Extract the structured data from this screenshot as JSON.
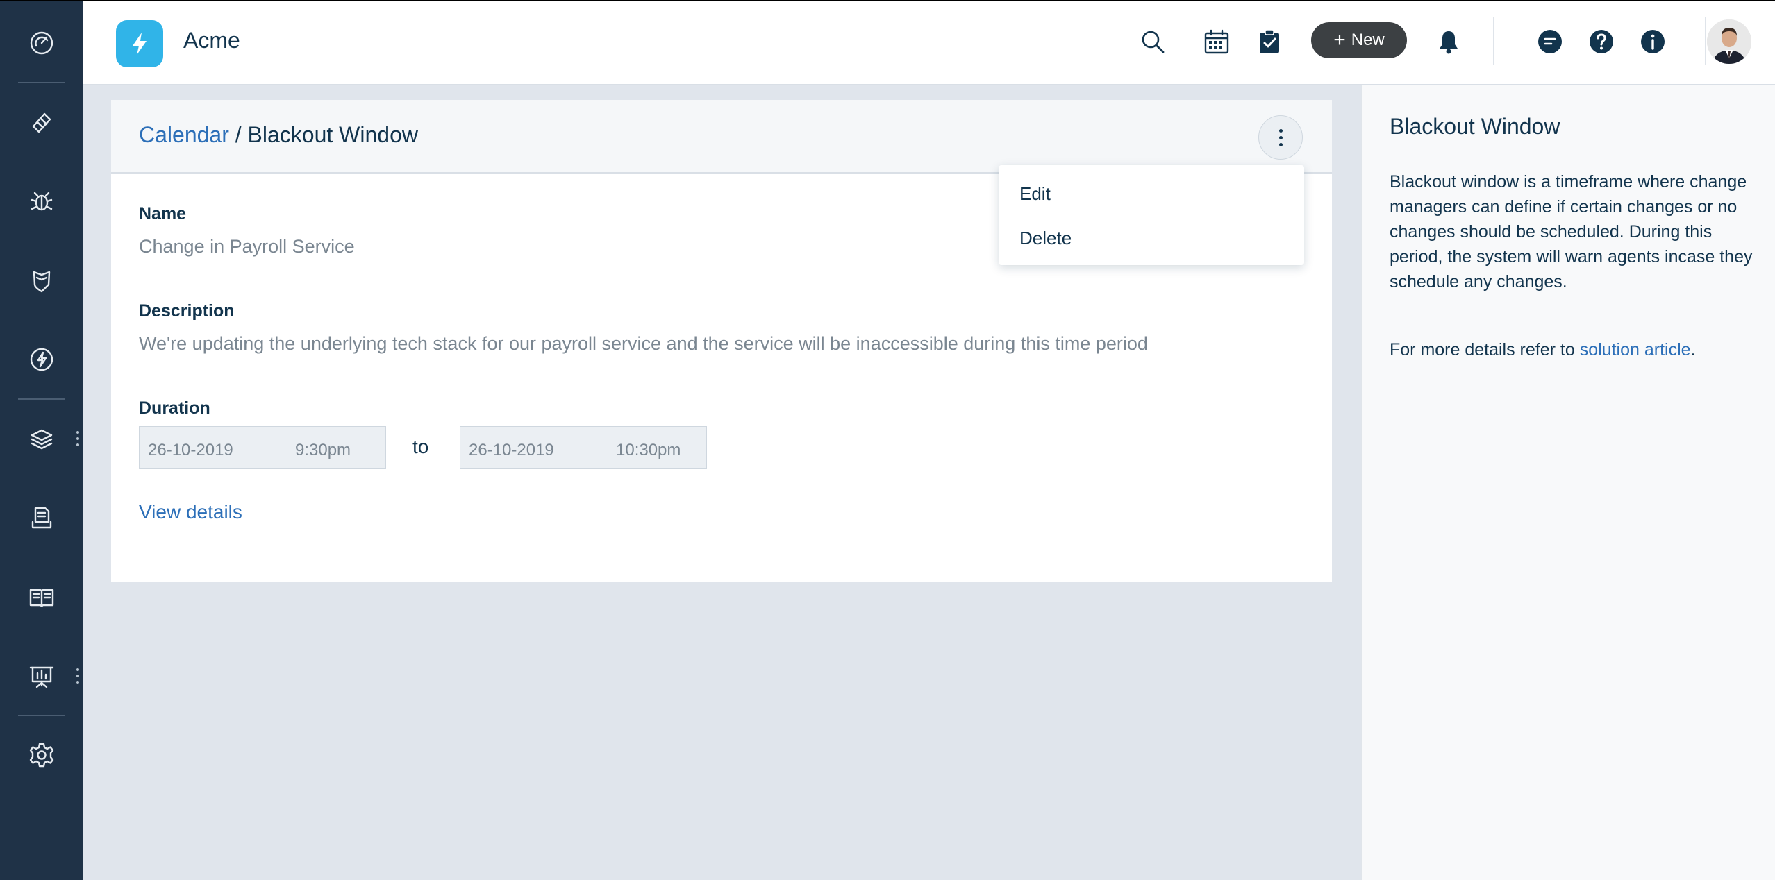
{
  "app": {
    "name": "Acme"
  },
  "header": {
    "new_label": "New"
  },
  "sidebar": {
    "items": [
      {
        "icon": "dashboard-icon"
      },
      {
        "icon": "tickets-icon"
      },
      {
        "icon": "bug-icon"
      },
      {
        "icon": "shield-icon"
      },
      {
        "icon": "changes-icon"
      },
      {
        "icon": "layers-icon"
      },
      {
        "icon": "inbox-icon"
      },
      {
        "icon": "book-icon"
      },
      {
        "icon": "reports-icon"
      },
      {
        "icon": "gear-icon"
      }
    ]
  },
  "breadcrumb": {
    "parent": "Calendar",
    "separator": " / ",
    "current": "Blackout Window"
  },
  "menu": {
    "edit": "Edit",
    "delete": "Delete"
  },
  "details": {
    "name_label": "Name",
    "name_value": "Change in Payroll Service",
    "description_label": "Description",
    "description_value": "We're updating the underlying tech stack for our payroll service and the service will be inaccessible during this time period",
    "duration_label": "Duration",
    "start_date": "26-10-2019",
    "start_time": "9:30pm",
    "to_label": "to",
    "end_date": "26-10-2019",
    "end_time": "10:30pm",
    "view_details": "View details"
  },
  "right_panel": {
    "title": "Blackout Window",
    "body": "Blackout window is a timeframe where change managers can define if certain changes or no changes should be scheduled. During this period, the system will warn agents incase they schedule any changes.",
    "more_prefix": "For more details refer to ",
    "more_link": "solution article",
    "more_suffix": "."
  },
  "colors": {
    "sidebar_bg": "#1f3247",
    "accent_link": "#2c6fb8",
    "logo_bg": "#30b4e8",
    "new_button_bg": "#3c4043"
  }
}
